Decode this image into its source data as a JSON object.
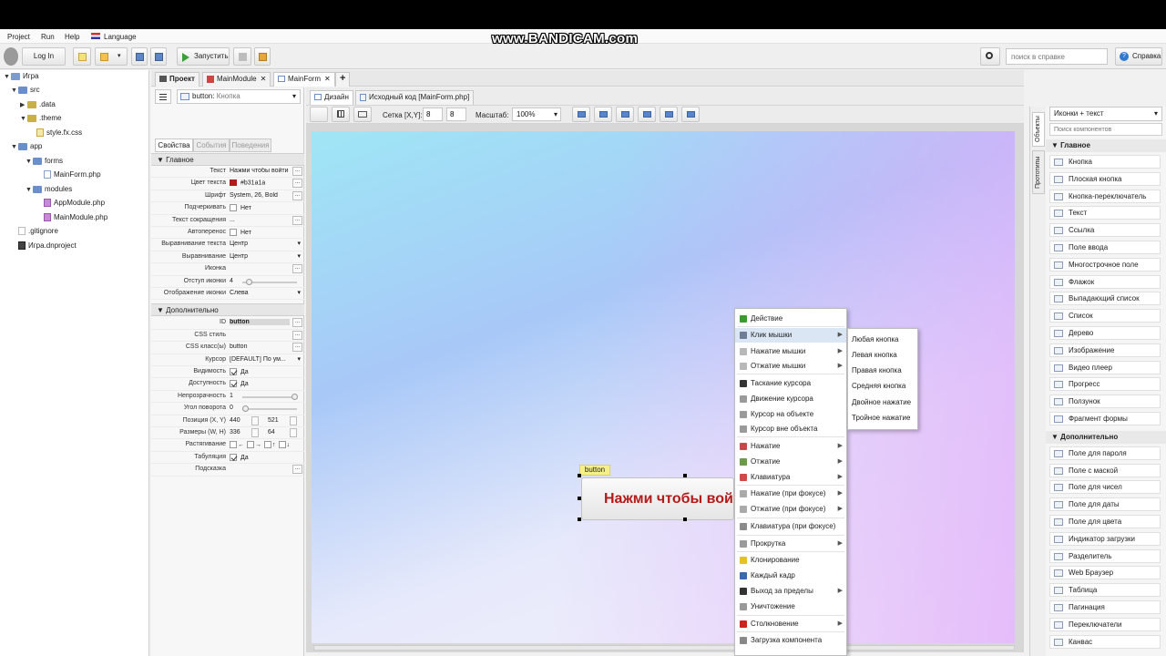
{
  "watermark": "www.BANDICAM.com",
  "menu": {
    "project": "Project",
    "run": "Run",
    "help": "Help",
    "language": "Language"
  },
  "toolbar": {
    "login": "Log In",
    "run": "Запустить",
    "search_placeholder": "поиск в справке",
    "help": "Справка"
  },
  "tree": {
    "root": "Игра",
    "src": ".src",
    "src_label": "src",
    "data": ".data",
    "theme": ".theme",
    "style": "style.fx.css",
    "app": "app",
    "forms": "forms",
    "mainform": "MainForm.php",
    "modules": "modules",
    "appmodule": "AppModule.php",
    "mainmodule": "MainModule.php",
    "gitignore": ".gitignore",
    "project": "Игра.dnproject"
  },
  "tabs": {
    "project": "Проект",
    "mainmodule": "MainModule",
    "mainform": "MainForm",
    "add": "+"
  },
  "props": {
    "selector_name": "button:",
    "selector_type": "Кнопка",
    "tab_props": "Свойства",
    "tab_events": "События",
    "tab_behaviors": "Поведения",
    "sec_main": "Главное",
    "sec_extra": "Дополнительно",
    "rows_main": [
      {
        "label": "Текст",
        "value": "Нажми чтобы войти"
      },
      {
        "label": "Цвет текста",
        "value": "#b31a1a"
      },
      {
        "label": "Шрифт",
        "value": "System, 26, Bold"
      },
      {
        "label": "Подчеркивать",
        "value": "Нет"
      },
      {
        "label": "Текст сокращения",
        "value": "..."
      },
      {
        "label": "Автоперенос",
        "value": "Нет"
      },
      {
        "label": "Выравнивание текста",
        "value": "Центр"
      },
      {
        "label": "Выравнивание",
        "value": "Центр"
      },
      {
        "label": "Иконка",
        "value": ""
      },
      {
        "label": "Отступ иконки",
        "value": "4"
      },
      {
        "label": "Отображение иконки",
        "value": "Слева"
      }
    ],
    "rows_extra": [
      {
        "label": "ID",
        "value": "button"
      },
      {
        "label": "CSS стиль",
        "value": ""
      },
      {
        "label": "CSS класс(ы)",
        "value": "button"
      },
      {
        "label": "Курсор",
        "value": "[DEFAULT] По ум..."
      },
      {
        "label": "Видимость",
        "value": "Да"
      },
      {
        "label": "Доступность",
        "value": "Да"
      },
      {
        "label": "Непрозрачность",
        "value": "1"
      },
      {
        "label": "Угол поворота",
        "value": "0"
      },
      {
        "label": "Позиция (X, Y)",
        "value": "440",
        "value2": "521"
      },
      {
        "label": "Размеры (W, H)",
        "value": "336",
        "value2": "64"
      },
      {
        "label": "Растягивание",
        "value": ""
      },
      {
        "label": "Табуляция",
        "value": "Да"
      },
      {
        "label": "Подсказка",
        "value": ""
      }
    ]
  },
  "design": {
    "tab_design": "Дизайн",
    "tab_source": "Исходный код [MainForm.php]",
    "grid_label": "Сетка [X,Y]:",
    "grid_x": "8",
    "grid_y": "8",
    "scale_label": "Масштаб:",
    "scale": "100%",
    "button_tag": "button",
    "button_text": "Нажми чтобы войти",
    "button_color": "#b31a1a"
  },
  "palette": {
    "vtab_objects": "Объекты",
    "vtab_prototypes": "Прототипы",
    "mode": "Иконки + текст",
    "search_placeholder": "Поиск компонентов",
    "sec_main": "Главное",
    "sec_extra": "Дополнительно",
    "main_items": [
      "Кнопка",
      "Плоская кнопка",
      "Кнопка-переключатель",
      "Текст",
      "Ссылка",
      "Поле ввода",
      "Многострочное поле",
      "Флажок",
      "Выпадающий список",
      "Список",
      "Дерево",
      "Изображение",
      "Видео плеер",
      "Прогресс",
      "Ползунок",
      "Фрагмент формы"
    ],
    "extra_items": [
      "Поле для пароля",
      "Поле с маской",
      "Поле для чисел",
      "Поле для даты",
      "Поле для цвета",
      "Индикатор загрузки",
      "Разделитель",
      "Web Браузер",
      "Таблица",
      "Пагинация",
      "Переключатели",
      "Канвас"
    ]
  },
  "context_menu": [
    {
      "label": "Действие",
      "sub": false,
      "color": "#3b9b2f"
    },
    {
      "label": "Клик мышки",
      "sub": true,
      "color": "#6e7e96"
    },
    {
      "label": "Нажатие мышки",
      "sub": true,
      "color": "#b8b8b8"
    },
    {
      "label": "Отжатие мышки",
      "sub": true,
      "color": "#b8b8b8"
    },
    {
      "label": "Таскание курсора",
      "sub": false,
      "color": "#333333"
    },
    {
      "label": "Движение курсора",
      "sub": false,
      "color": "#9a9a9a"
    },
    {
      "label": "Курсор на объекте",
      "sub": false,
      "color": "#9a9a9a"
    },
    {
      "label": "Курсор вне объекта",
      "sub": false,
      "color": "#9a9a9a"
    },
    {
      "label": "Нажатие",
      "sub": true,
      "color": "#c44a4a"
    },
    {
      "label": "Отжатие",
      "sub": true,
      "color": "#6a9a4a"
    },
    {
      "label": "Клавиатура",
      "sub": true,
      "color": "#d04a4a"
    },
    {
      "label": "Нажатие (при фокусе)",
      "sub": true,
      "color": "#aaaaaa"
    },
    {
      "label": "Отжатие (при фокусе)",
      "sub": true,
      "color": "#aaaaaa"
    },
    {
      "label": "Клавиатура (при фокусе)",
      "sub": false,
      "color": "#8a8a8a"
    },
    {
      "label": "Прокрутка",
      "sub": true,
      "color": "#9a9a9a"
    },
    {
      "label": "Клонирование",
      "sub": false,
      "color": "#e8c020"
    },
    {
      "label": "Каждый кадр",
      "sub": false,
      "color": "#3a6ab0"
    },
    {
      "label": "Выход за пределы",
      "sub": true,
      "color": "#333333"
    },
    {
      "label": "Уничтожение",
      "sub": false,
      "color": "#999999"
    },
    {
      "label": "Столкновение",
      "sub": true,
      "color": "#d02020"
    },
    {
      "label": "Загрузка компонента",
      "sub": false,
      "color": "#888888"
    }
  ],
  "submenu": [
    "Любая кнопка",
    "Левая кнопка",
    "Правая кнопка",
    "Средняя кнопка",
    "Двойное нажатие",
    "Тройное нажатие"
  ]
}
